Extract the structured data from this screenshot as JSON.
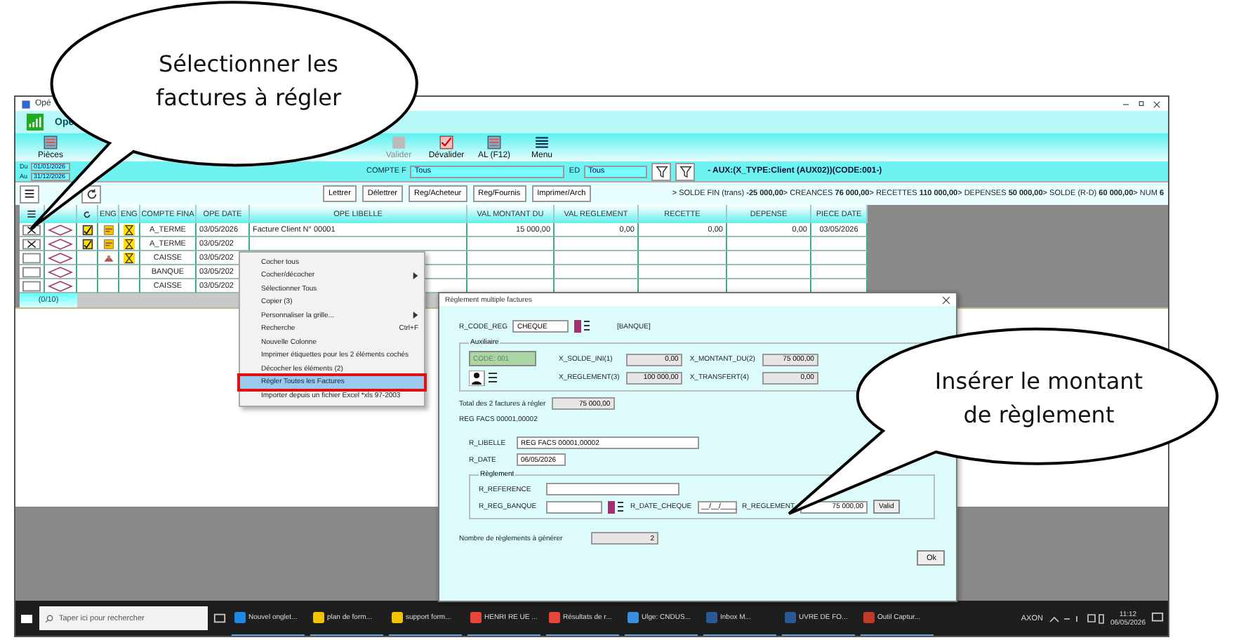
{
  "window": {
    "title": "Opé",
    "app_name": "Opé"
  },
  "toolbar": [
    {
      "label": "Pièces",
      "disabled": false
    },
    {
      "label": "Valider",
      "disabled": true
    },
    {
      "label": "Dévalider",
      "disabled": false
    },
    {
      "label": "AL (F12)",
      "disabled": false
    },
    {
      "label": "Menu",
      "disabled": false
    }
  ],
  "filters": {
    "from_label": "Du",
    "from": "01/01/2026",
    "to_label": "Au",
    "to": "31/12/2026",
    "account_label": "COMPTE F",
    "account": "Tous",
    "ed_label": "ED",
    "ed": "Tous",
    "aux": "- AUX:(X_TYPE:Client (AUX02))(CODE:001-)"
  },
  "actions": [
    "Lettrer",
    "Délettrer",
    "Reg/Acheteur",
    "Reg/Fournis",
    "Imprimer/Arch"
  ],
  "summary": "> SOLDE FIN (trans) **-25 000,00**> CREANCES **76 000,00**> RECETTES **110 000,00**> DEPENSES **50 000,00**> SOLDE (R-D) **60 000,00**> NUM **6**",
  "table": {
    "eng_columns": [
      "ENG",
      "ENG"
    ],
    "columns": [
      "COMPTE FINA",
      "OPE DATE",
      "OPE LIBELLE",
      "VAL MONTANT DU",
      "VAL REGLEMENT",
      "RECETTE",
      "DEPENSE",
      "PIECE DATE"
    ],
    "rows": [
      {
        "checked": true,
        "lettered": true,
        "invoiced": true,
        "cash": false,
        "pending": true,
        "cells": [
          "A_TERME",
          "03/05/2026",
          "Facture Client N° 00001",
          "15 000,00",
          "0,00",
          "0,00",
          "0,00",
          "03/05/2026"
        ]
      },
      {
        "checked": true,
        "lettered": true,
        "invoiced": true,
        "cash": false,
        "pending": true,
        "cells": [
          "A_TERME",
          "03/05/202"
        ]
      },
      {
        "checked": false,
        "lettered": false,
        "invoiced": false,
        "cash": true,
        "pending": true,
        "cells": [
          "CAISSE",
          "03/05/202"
        ]
      },
      {
        "checked": false,
        "lettered": false,
        "invoiced": false,
        "cash": false,
        "pending": false,
        "cells": [
          "BANQUE",
          "03/05/202"
        ]
      },
      {
        "checked": false,
        "lettered": false,
        "invoiced": false,
        "cash": false,
        "pending": false,
        "cells": [
          "CAISSE",
          "03/05/202"
        ]
      }
    ],
    "footer": "(0/10)"
  },
  "context_menu": [
    {
      "label": "Cocher tous",
      "submenu": false,
      "highlighted": false
    },
    {
      "label": "Cocher/décocher",
      "submenu": true,
      "highlighted": false
    },
    {
      "label": "Sélectionner Tous",
      "submenu": false,
      "highlighted": false
    },
    {
      "label": "Copier (3)",
      "submenu": false,
      "highlighted": false
    },
    {
      "label": "Personnaliser la grille...",
      "submenu": true,
      "highlighted": false
    },
    {
      "label": "Recherche",
      "shortcut": "Ctrl+F",
      "submenu": false,
      "highlighted": false
    },
    {
      "label": "Nouvelle Colonne",
      "submenu": false,
      "highlighted": false
    },
    {
      "label": "Imprimer étiquettes pour les 2 éléments cochés",
      "submenu": false,
      "highlighted": false
    },
    {
      "label": "Décocher les éléments (2)",
      "submenu": false,
      "highlighted": false
    },
    {
      "label": "Régler Toutes les Factures",
      "submenu": false,
      "highlighted": true
    },
    {
      "label": "Importer depuis un fichier Excel *xls 97-2003",
      "submenu": false,
      "highlighted": false
    }
  ],
  "dialog": {
    "title": "Règlement multiple factures",
    "code_label": "R_CODE_REG",
    "code": "CHEQUE",
    "code_name": "[BANQUE]",
    "aux_group": "Auxiliaire",
    "aux_code": "CODE: 001",
    "aux_fields": [
      {
        "label": "X_SOLDE_INI(1)",
        "value": "0,00"
      },
      {
        "label": "X_MONTANT_DU(2)",
        "value": "75 000,00"
      },
      {
        "label": "X_REGLEMENT(3)",
        "value": "100 000,00"
      },
      {
        "label": "X_TRANSFERT(4)",
        "value": "0,00"
      }
    ],
    "total_label": "Total des 2 factures à régler",
    "total": "75 000,00",
    "ref_line": "REG FACS 00001,00002",
    "libelle_label": "R_LIBELLE",
    "libelle": "REG FACS 00001,00002",
    "date_label": "R_DATE",
    "date": "06/05/2026",
    "reg_group": "Règlement",
    "reference_label": "R_REFERENCE",
    "bank_label": "R_REG_BANQUE",
    "cheque_date_label": "R_DATE_CHEQUE",
    "cheque_date": "__/__/____",
    "amount_label": "R_REGLEMENT",
    "amount": "75 000,00",
    "validate": "Valid",
    "count_label": "Nombre de règlements à générer",
    "count": "2",
    "ok": "Ok"
  },
  "taskbar": {
    "search_placeholder": "Taper ici pour rechercher",
    "apps": [
      {
        "label": "Nouvel onglet...",
        "color": "#1e88e5"
      },
      {
        "label": "plan de form...",
        "color": "#f2c200"
      },
      {
        "label": "support form...",
        "color": "#f2c200"
      },
      {
        "label": "HENRI RE UE ...",
        "color": "#e8453c"
      },
      {
        "label": "Résultats de r...",
        "color": "#e8453c"
      },
      {
        "label": "Ulge: CNDUS...",
        "color": "#3a8fe0"
      },
      {
        "label": "Inbox M...",
        "color": "#2b5797"
      },
      {
        "label": "UVRE DE FO...",
        "color": "#2b5797"
      },
      {
        "label": "Outil Captur...",
        "color": "#c0392b"
      }
    ],
    "tray_label": "AXON",
    "time": "11:12",
    "date": "06/05/2026"
  },
  "callouts": [
    {
      "text": "Sélectionner les factures à régler"
    },
    {
      "text": "Insérer le montant de règlement"
    }
  ]
}
